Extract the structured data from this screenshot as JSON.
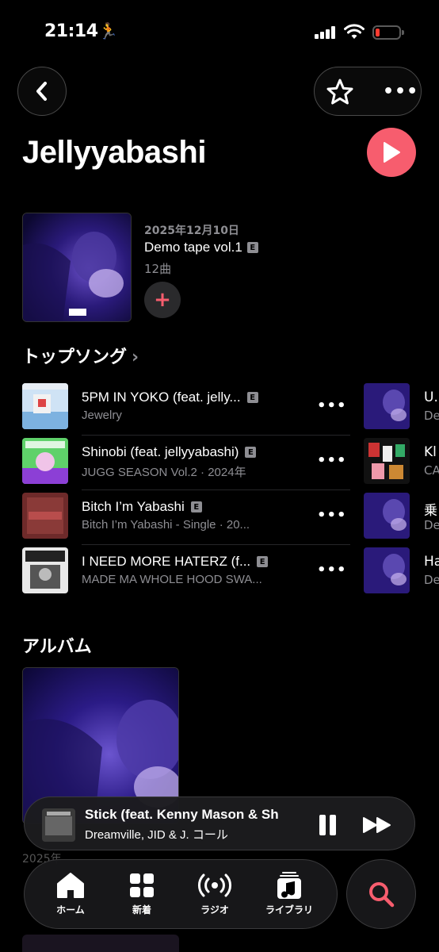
{
  "status_bar": {
    "time": "21:14"
  },
  "header": {
    "artist_name": "Jellyyabashi"
  },
  "latest_release": {
    "date": "2025年12月10日",
    "title": "Demo tape vol.1",
    "explicit": "E",
    "track_count": "12曲",
    "add_label": "+"
  },
  "top_songs": {
    "title": "トップソング",
    "items": [
      {
        "title": "5PM IN YOKO (feat. jelly...",
        "explicit": "E",
        "subtitle": "Jewelry"
      },
      {
        "title": "Shinobi (feat. jellyyabashi)",
        "explicit": "E",
        "subtitle": "JUGG SEASON Vol.2 · 2024年"
      },
      {
        "title": "Bitch I’m Yabashi",
        "explicit": "E",
        "subtitle": "Bitch I’m Yabashi - Single · 20..."
      },
      {
        "title": "I NEED MORE HATERZ (f...",
        "explicit": "E",
        "subtitle": "MADE MA WHOLE HOOD SWA..."
      }
    ],
    "second_column": [
      {
        "title": "U.",
        "subtitle": "De"
      },
      {
        "title": "Kl",
        "subtitle": "CA"
      },
      {
        "title": "乗",
        "subtitle": "De"
      },
      {
        "title": "Ha",
        "subtitle": "De"
      }
    ]
  },
  "albums": {
    "title": "アルバム",
    "first_meta": "2025年"
  },
  "now_playing": {
    "title": "Stick (feat. Kenny Mason & Sh",
    "artist": "Dreamville, JID & J. コール"
  },
  "tabs": [
    {
      "label": "ホーム",
      "icon": "home-icon",
      "active": true
    },
    {
      "label": "新着",
      "icon": "grid-icon"
    },
    {
      "label": "ラジオ",
      "icon": "radio-icon"
    },
    {
      "label": "ライブラリ",
      "icon": "library-icon"
    }
  ],
  "colors": {
    "accent": "#f75d6e",
    "secondary_text": "#8e8e93",
    "background": "#000000"
  }
}
